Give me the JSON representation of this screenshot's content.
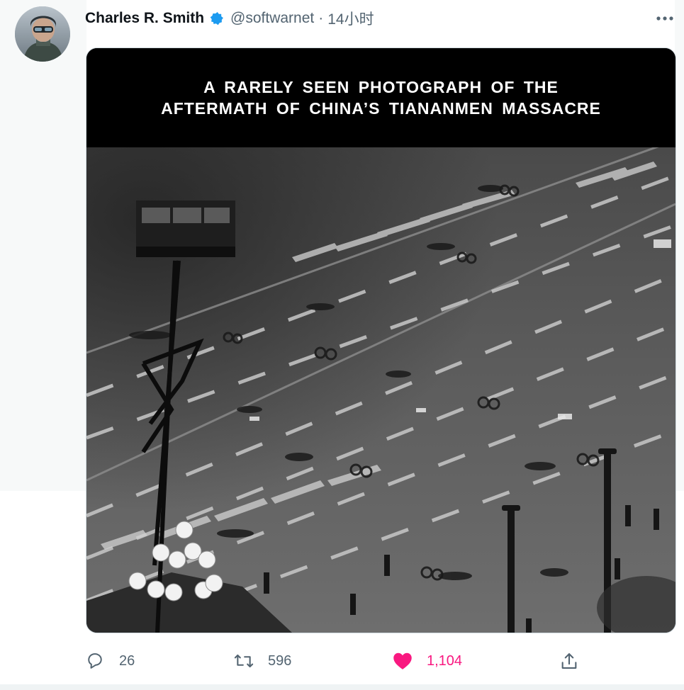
{
  "tweet": {
    "author_name": "Charles R. Smith",
    "handle": "@softwarnet",
    "separator": "·",
    "time": "14小时",
    "verified_icon": "verified-badge-icon",
    "more_icon": "more-horizontal-icon"
  },
  "media": {
    "caption": "A RARELY SEEN PHOTOGRAPH OF THE\nAFTERMATH OF CHINA’S TIANANMEN MASSACRE"
  },
  "actions": {
    "reply": {
      "icon": "reply-icon",
      "count": "26"
    },
    "retweet": {
      "icon": "retweet-icon",
      "count": "596"
    },
    "like": {
      "icon": "heart-icon",
      "count": "1,104",
      "liked": true
    },
    "share": {
      "icon": "share-icon"
    }
  },
  "colors": {
    "text_primary": "#0f1419",
    "text_secondary": "#536471",
    "verified": "#1d9bf0",
    "like_active": "#f91880"
  }
}
